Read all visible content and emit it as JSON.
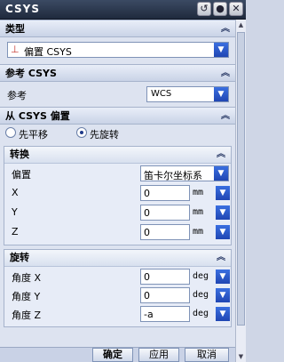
{
  "window": {
    "title": "CSYS"
  },
  "sections": {
    "type": {
      "title": "类型",
      "value": "偏置 CSYS"
    },
    "ref": {
      "title": "参考 CSYS",
      "label": "参考",
      "value": "WCS"
    },
    "from": {
      "title": "从 CSYS 偏置",
      "radio": {
        "option1": "先平移",
        "option2": "先旋转"
      },
      "translate": {
        "title": "转换",
        "offset_label": "偏置",
        "offset_value": "笛卡尔坐标系",
        "x_label": "X",
        "x_value": "0",
        "x_unit": "mm",
        "y_label": "Y",
        "y_value": "0",
        "y_unit": "mm",
        "z_label": "Z",
        "z_value": "0",
        "z_unit": "mm"
      },
      "rotate": {
        "title": "旋转",
        "ax_label": "角度 X",
        "ax_value": "0",
        "ax_unit": "deg",
        "ay_label": "角度 Y",
        "ay_value": "0",
        "ay_unit": "deg",
        "az_label": "角度 Z",
        "az_value": "-a",
        "az_unit": "deg"
      }
    }
  },
  "footer": {
    "ok": "确定",
    "apply": "应用",
    "cancel": "取消"
  },
  "colors": {
    "title_bg": "#2a354b",
    "section_bg": "#dde3f0",
    "accent": "#2046b3"
  }
}
